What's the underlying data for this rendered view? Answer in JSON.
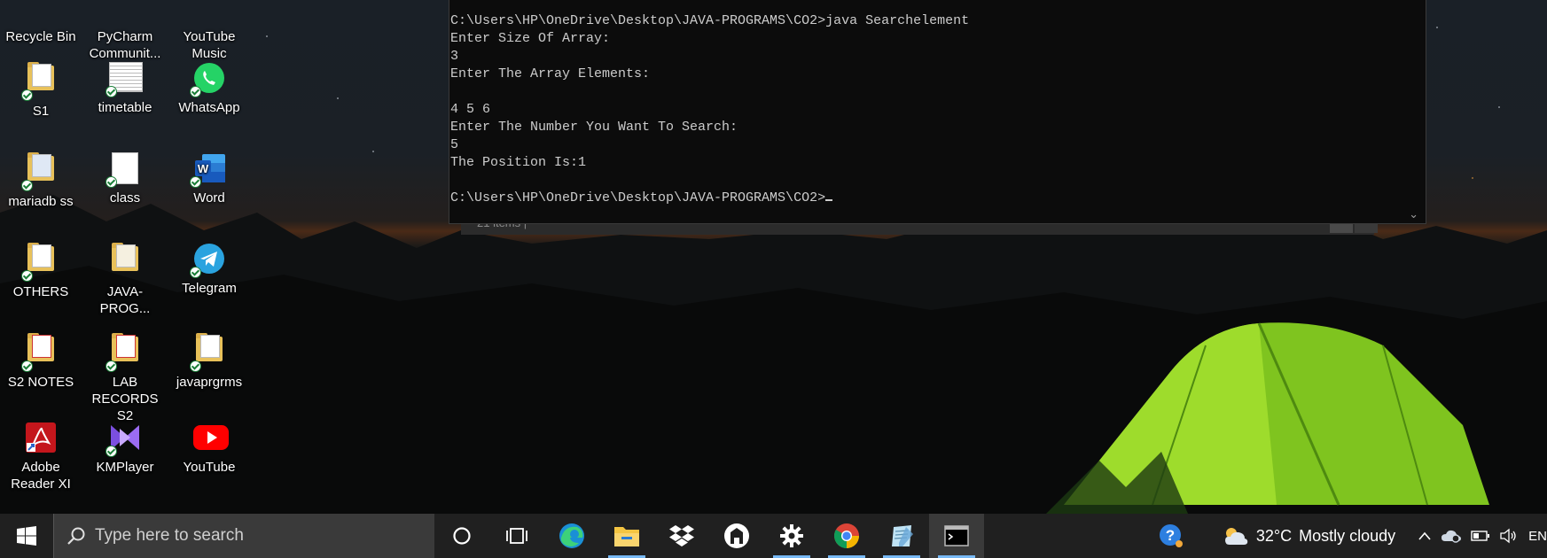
{
  "desktop": {
    "icons": [
      {
        "label": "Recycle Bin"
      },
      {
        "label": "PyCharm Communit..."
      },
      {
        "label": "YouTube Music"
      },
      {
        "label": "S1"
      },
      {
        "label": "timetable"
      },
      {
        "label": "WhatsApp"
      },
      {
        "label": "mariadb ss"
      },
      {
        "label": "class"
      },
      {
        "label": "Word"
      },
      {
        "label": "OTHERS"
      },
      {
        "label": "JAVA-PROG..."
      },
      {
        "label": "Telegram"
      },
      {
        "label": "S2 NOTES"
      },
      {
        "label": "LAB RECORDS S2"
      },
      {
        "label": "javaprgrms"
      },
      {
        "label": "Adobe Reader XI"
      },
      {
        "label": "KMPlayer"
      },
      {
        "label": "YouTube"
      }
    ]
  },
  "console": {
    "lines": [
      "C:\\Users\\HP\\OneDrive\\Desktop\\JAVA-PROGRAMS\\CO2>java Searchelement",
      "Enter Size Of Array:",
      "3",
      "Enter The Array Elements:",
      "",
      "4 5 6",
      "Enter The Number You Want To Search:",
      "5",
      "The Position Is:1",
      ""
    ],
    "prompt": "C:\\Users\\HP\\OneDrive\\Desktop\\JAVA-PROGRAMS\\CO2>",
    "scroll_icon": "chevron-down-icon"
  },
  "background_window": {
    "status_text": "21 items  |"
  },
  "taskbar": {
    "search_placeholder": "Type here to search",
    "apps": [
      {
        "name": "cortana-icon"
      },
      {
        "name": "task-view-icon"
      },
      {
        "name": "edge-icon"
      },
      {
        "name": "file-explorer-icon"
      },
      {
        "name": "dropbox-icon"
      },
      {
        "name": "github-desktop-icon"
      },
      {
        "name": "settings-icon"
      },
      {
        "name": "chrome-icon"
      },
      {
        "name": "notepad-icon"
      },
      {
        "name": "command-prompt-icon"
      }
    ],
    "weather": {
      "temp": "32°C",
      "condition": "Mostly cloudy"
    },
    "language": "EN"
  },
  "colors": {
    "taskbar": "#202020",
    "console_bg": "#0c0c0c",
    "console_text": "#cccccc",
    "accent": "#77b9f5"
  }
}
